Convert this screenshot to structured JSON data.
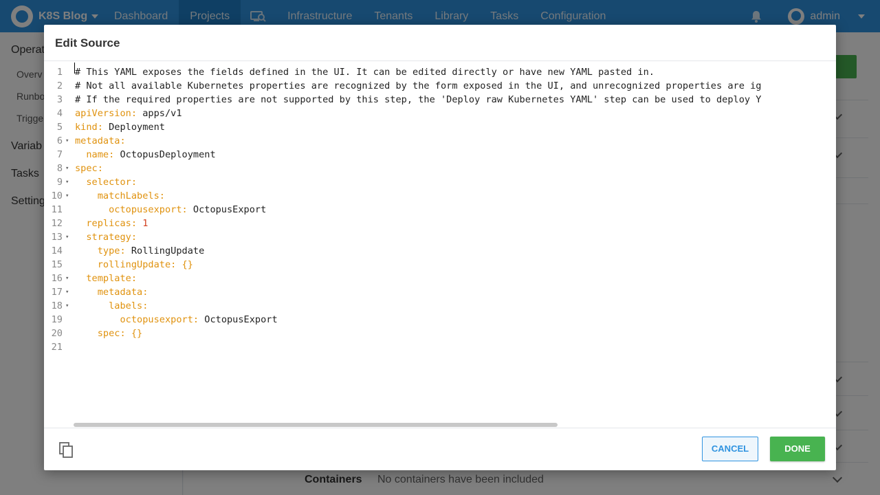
{
  "nav": {
    "brand": "K8S Blog",
    "items": [
      "Dashboard",
      "Projects",
      "Infrastructure",
      "Tenants",
      "Library",
      "Tasks",
      "Configuration"
    ],
    "active": "Projects",
    "user": "admin",
    "icons": {
      "logo": "octopus-logo-icon",
      "search_machines": "machine-search-icon",
      "bell": "bell-icon",
      "avatar": "avatar-icon"
    }
  },
  "sidebar": {
    "sections": [
      "Operat",
      "Variab",
      "Tasks",
      "Setting"
    ],
    "subitems": [
      "Overv",
      "Runbo",
      "Trigge"
    ]
  },
  "background": {
    "containers_label": "Containers",
    "containers_value": "No containers have been included"
  },
  "modal": {
    "title": "Edit Source",
    "lines": [
      {
        "n": "1",
        "fold": false,
        "indent": "",
        "key": "",
        "sep": "",
        "value": "",
        "comment": "# This YAML exposes the fields defined in the UI. It can be edited directly or have new YAML pasted in."
      },
      {
        "n": "2",
        "fold": false,
        "indent": "",
        "key": "",
        "sep": "",
        "value": "",
        "comment": "# Not all available Kubernetes properties are recognized by the form exposed in the UI, and unrecognized properties are ig"
      },
      {
        "n": "3",
        "fold": false,
        "indent": "",
        "key": "",
        "sep": "",
        "value": "",
        "comment": "# If the required properties are not supported by this step, the 'Deploy raw Kubernetes YAML' step can be used to deploy Y"
      },
      {
        "n": "4",
        "fold": false,
        "indent": "",
        "key": "apiVersion",
        "sep": ": ",
        "value": "apps/v1",
        "comment": ""
      },
      {
        "n": "5",
        "fold": false,
        "indent": "",
        "key": "kind",
        "sep": ": ",
        "value": "Deployment",
        "comment": ""
      },
      {
        "n": "6",
        "fold": true,
        "indent": "",
        "key": "metadata",
        "sep": ":",
        "value": "",
        "comment": ""
      },
      {
        "n": "7",
        "fold": false,
        "indent": "  ",
        "key": "name",
        "sep": ": ",
        "value": "OctopusDeployment",
        "comment": ""
      },
      {
        "n": "8",
        "fold": true,
        "indent": "",
        "key": "spec",
        "sep": ":",
        "value": "",
        "comment": ""
      },
      {
        "n": "9",
        "fold": true,
        "indent": "  ",
        "key": "selector",
        "sep": ":",
        "value": "",
        "comment": ""
      },
      {
        "n": "10",
        "fold": true,
        "indent": "    ",
        "key": "matchLabels",
        "sep": ":",
        "value": "",
        "comment": ""
      },
      {
        "n": "11",
        "fold": false,
        "indent": "      ",
        "key": "octopusexport",
        "sep": ": ",
        "value": "OctopusExport",
        "comment": ""
      },
      {
        "n": "12",
        "fold": false,
        "indent": "  ",
        "key": "replicas",
        "sep": ": ",
        "value": "1",
        "num": true,
        "comment": ""
      },
      {
        "n": "13",
        "fold": true,
        "indent": "  ",
        "key": "strategy",
        "sep": ":",
        "value": "",
        "comment": ""
      },
      {
        "n": "14",
        "fold": false,
        "indent": "    ",
        "key": "type",
        "sep": ": ",
        "value": "RollingUpdate",
        "comment": ""
      },
      {
        "n": "15",
        "fold": false,
        "indent": "    ",
        "key": "rollingUpdate",
        "sep": ": ",
        "value": "{}",
        "brace": true,
        "comment": ""
      },
      {
        "n": "16",
        "fold": true,
        "indent": "  ",
        "key": "template",
        "sep": ":",
        "value": "",
        "comment": ""
      },
      {
        "n": "17",
        "fold": true,
        "indent": "    ",
        "key": "metadata",
        "sep": ":",
        "value": "",
        "comment": ""
      },
      {
        "n": "18",
        "fold": true,
        "indent": "      ",
        "key": "labels",
        "sep": ":",
        "value": "",
        "comment": ""
      },
      {
        "n": "19",
        "fold": false,
        "indent": "        ",
        "key": "octopusexport",
        "sep": ": ",
        "value": "OctopusExport",
        "comment": ""
      },
      {
        "n": "20",
        "fold": false,
        "indent": "    ",
        "key": "spec",
        "sep": ": ",
        "value": "{}",
        "brace": true,
        "comment": ""
      },
      {
        "n": "21",
        "fold": false,
        "indent": "",
        "key": "",
        "sep": "",
        "value": "",
        "comment": ""
      }
    ],
    "cancel_label": "CANCEL",
    "done_label": "DONE",
    "copy_icon": "copy-icon"
  },
  "colors": {
    "nav_bg": "#2f93e0",
    "nav_active": "#1f7fc9",
    "yaml_key": "#e0920e",
    "yaml_number": "#d23f1f",
    "done_green": "#48b350",
    "cancel_blue": "#2f93e0"
  }
}
